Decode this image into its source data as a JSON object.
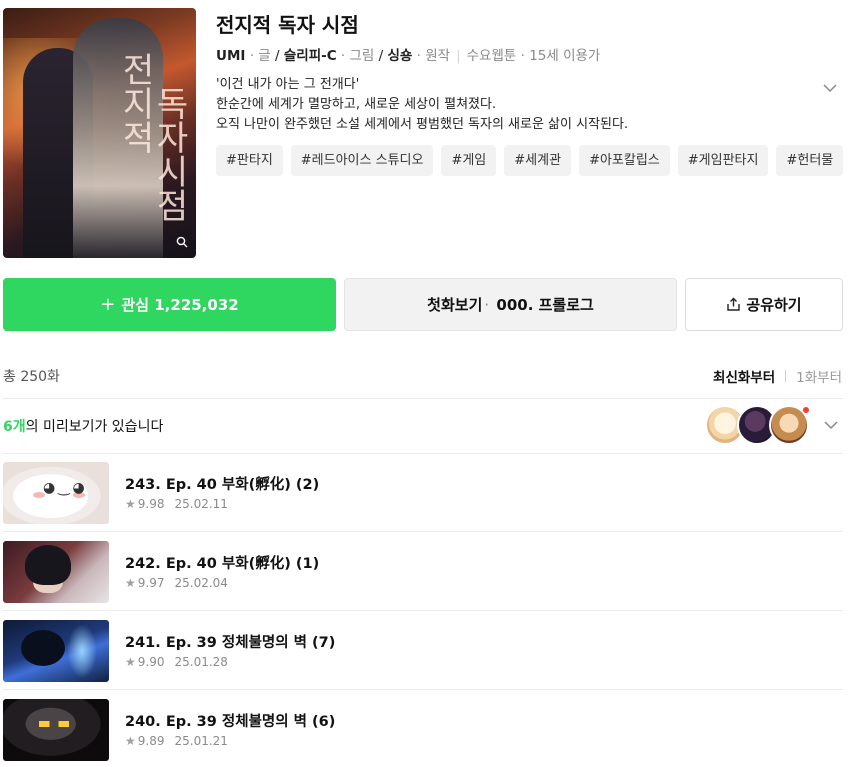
{
  "webtoon": {
    "title": "전지적 독자 시점",
    "cover_text_1": "전지적",
    "cover_text_2": "독자시점",
    "credits": [
      {
        "name": "UMI",
        "role": "글"
      },
      {
        "name": "슬리피-C",
        "role": "그림"
      },
      {
        "name": "싱숑",
        "role": "원작"
      }
    ],
    "schedule": "수요웹툰",
    "age": "15세 이용가",
    "description": [
      "'이건 내가 아는 그 전개다'",
      "한순간에 세계가 멸망하고, 새로운 세상이 펼쳐졌다.",
      "오직 나만이 완주했던 소설 세계에서 평범했던 독자의 새로운 삶이 시작된다."
    ],
    "tags": [
      "#판타지",
      "#레드아이스 스튜디오",
      "#게임",
      "#세계관",
      "#아포칼립스",
      "#게임판타지",
      "#헌터물"
    ]
  },
  "actions": {
    "favorite_label": "관심",
    "favorite_count": "1,225,032",
    "first_label": "첫화보기",
    "first_episode": "000. 프롤로그",
    "share_label": "공유하기"
  },
  "list": {
    "total": "총 250화",
    "sort_latest": "최신화부터",
    "sort_first": "1화부터",
    "preview_count": "6개",
    "preview_text": "의 미리보기가 있습니다"
  },
  "episodes": [
    {
      "title": "243. Ep. 40 부화(孵化) (2)",
      "rating": "9.98",
      "date": "25.02.11"
    },
    {
      "title": "242. Ep. 40 부화(孵化) (1)",
      "rating": "9.97",
      "date": "25.02.04"
    },
    {
      "title": "241. Ep. 39 정체불명의 벽 (7)",
      "rating": "9.90",
      "date": "25.01.28"
    },
    {
      "title": "240. Ep. 39 정체불명의 벽 (6)",
      "rating": "9.89",
      "date": "25.01.21"
    }
  ],
  "colors": {
    "accent_green": "#2fd660",
    "tag_bg": "#f2f2f2",
    "muted_text": "#8a8a8a"
  },
  "icons": {
    "cover_zoom": "search-icon",
    "favorite": "plus-icon",
    "share": "share-icon",
    "toggle": "chevron-down-icon",
    "rating": "star-icon"
  }
}
